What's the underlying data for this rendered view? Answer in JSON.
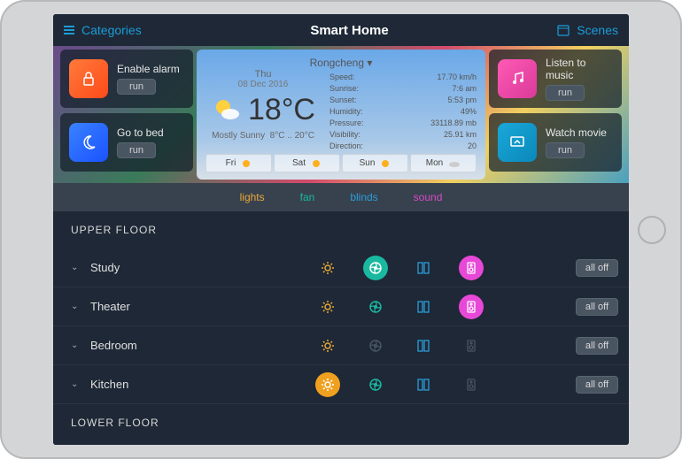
{
  "header": {
    "categories": "Categories",
    "title": "Smart Home",
    "scenes": "Scenes"
  },
  "scenes": {
    "left": [
      {
        "label": "Enable alarm",
        "run": "run"
      },
      {
        "label": "Go to bed",
        "run": "run"
      }
    ],
    "right": [
      {
        "label": "Listen to music",
        "run": "run"
      },
      {
        "label": "Watch movie",
        "run": "run"
      }
    ]
  },
  "weather": {
    "location": "Rongcheng",
    "day": "Thu",
    "date": "08 Dec 2016",
    "temp": "18°C",
    "condition": "Mostly Sunny",
    "range": "8°C .. 20°C",
    "details": {
      "speed_k": "Speed:",
      "speed_v": "17.70 km/h",
      "sunrise_k": "Sunrise:",
      "sunrise_v": "7:6 am",
      "sunset_k": "Sunset:",
      "sunset_v": "5:53 pm",
      "humidity_k": "Humidity:",
      "humidity_v": "49%",
      "pressure_k": "Pressure:",
      "pressure_v": "33118.89 mb",
      "visibility_k": "Visibility:",
      "visibility_v": "25.91 km",
      "direction_k": "Direction:",
      "direction_v": "20"
    },
    "forecast": [
      "Fri",
      "Sat",
      "Sun",
      "Mon"
    ]
  },
  "legend": {
    "lights": "lights",
    "fan": "fan",
    "blinds": "blinds",
    "sound": "sound"
  },
  "sections": {
    "upper": "UPPER FLOOR",
    "lower": "LOWER FLOOR"
  },
  "rooms": [
    {
      "name": "Study"
    },
    {
      "name": "Theater"
    },
    {
      "name": "Bedroom"
    },
    {
      "name": "Kitchen"
    }
  ],
  "alloff": "all off"
}
